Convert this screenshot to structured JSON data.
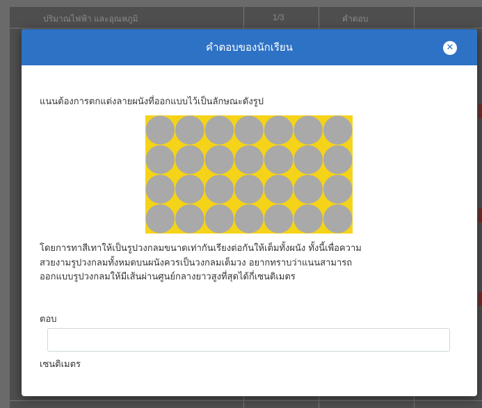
{
  "background": {
    "row_title": "ปริมาณไฟฟ้า และอุณหภูมิ",
    "row_fraction": "1/3",
    "row_status": "คำตอบ"
  },
  "modal": {
    "title": "คำตอบของนักเรียน",
    "close_icon": "close-icon",
    "question_line": "แนนต้องการตกแต่งลายผนังที่ออกแบบไว้เป็นลักษณะดังรูป",
    "figure": {
      "rows": 4,
      "cols": 7,
      "background_color": "#f5d318",
      "circle_color": "#a9a9a9"
    },
    "body_lines": [
      "โดยการทาสีเทาให้เป็นรูปวงกลมขนาดเท่ากันเรียงต่อกันให้เต็มทั้งผนัง  ทั้งนี้เพื่อความ",
      "สวยงามรูปวงกลมทั้งหมดบนผนังควรเป็นวงกลมเต็มวง  อยากทราบว่าแนนสามารถ",
      "ออกแบบรูปวงกลมให้มีเส้นผ่านศูนย์กลางยาวสูงที่สุดได้กี่เซนติเมตร"
    ],
    "answer_label": "ตอบ",
    "answer_value": "",
    "unit_label": "เซนติเมตร"
  },
  "colors": {
    "header": "#2e72c5",
    "overlay": "#5a5a5a"
  }
}
